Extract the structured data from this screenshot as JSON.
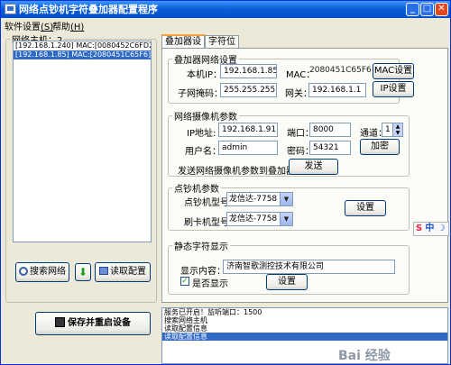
{
  "window": {
    "title": "网络点钞机字符叠加器配置程序"
  },
  "menu": {
    "items": [
      {
        "label": "软件设置",
        "key": "(S)"
      },
      {
        "label": "帮助",
        "key": "(H)"
      }
    ]
  },
  "host_group": {
    "title": "网络主机：2",
    "items": [
      {
        "text": "[192.168.1.240] MAC:[0080452C6FD2]",
        "selected": false
      },
      {
        "text": "[192.168.1.85] MAC:[2080451C65F6]",
        "selected": true
      }
    ],
    "search_button": "搜索网络",
    "read_button": "读取配置",
    "save_button": "保存并重启设备"
  },
  "tabs": [
    {
      "label": "叠加器设置",
      "active": true
    },
    {
      "label": "字符位置",
      "active": false
    }
  ],
  "overlay_net": {
    "title": "叠加器网络设置",
    "ip_label": "本机IP：",
    "ip_value": "192.168.1.85",
    "mac_label": "MAC：",
    "mac_value": "2080451C65F6",
    "mac_button": "MAC设置",
    "mask_label": "子网掩码：",
    "mask_value": "255.255.255.0",
    "gateway_label": "网关：",
    "gateway_value": "192.168.1.1",
    "ip_button": "IP设置"
  },
  "camera": {
    "title": "网络摄像机参数",
    "ip_label": "IP地址:",
    "ip_value": "192.168.1.91",
    "port_label": "端口：",
    "port_value": "8000",
    "channel_label": "通道：",
    "channel_value": "1",
    "user_label": "用户名：",
    "user_value": "admin",
    "pwd_label": "密码：",
    "pwd_value": "54321",
    "encrypt_button": "加密",
    "send_label": "发送网络摄像机参数到叠加器",
    "send_button": "发送"
  },
  "counter": {
    "title": "点钞机参数",
    "model_label": "点钞机型号：",
    "model_value": "龙信达-7758",
    "card_label": "刷卡机型号：",
    "card_value": "龙信达-7758",
    "set_button": "设置"
  },
  "static_text": {
    "title": "静态字符显示",
    "content_label": "显示内容：",
    "content_value": "济南智歌测控技术有限公司",
    "show_label": "是否显示",
    "show_checked": true,
    "set_button": "设置"
  },
  "log": {
    "rows": [
      {
        "text": "服务已开启！监听端口：1500",
        "selected": false
      },
      {
        "text": "搜索网络主机",
        "selected": false
      },
      {
        "text": "读取配置信息",
        "selected": false
      },
      {
        "text": "读取配置信息",
        "selected": true
      }
    ]
  },
  "ime": {
    "s": "S",
    "label": "中"
  },
  "watermark": "Bai 经验"
}
